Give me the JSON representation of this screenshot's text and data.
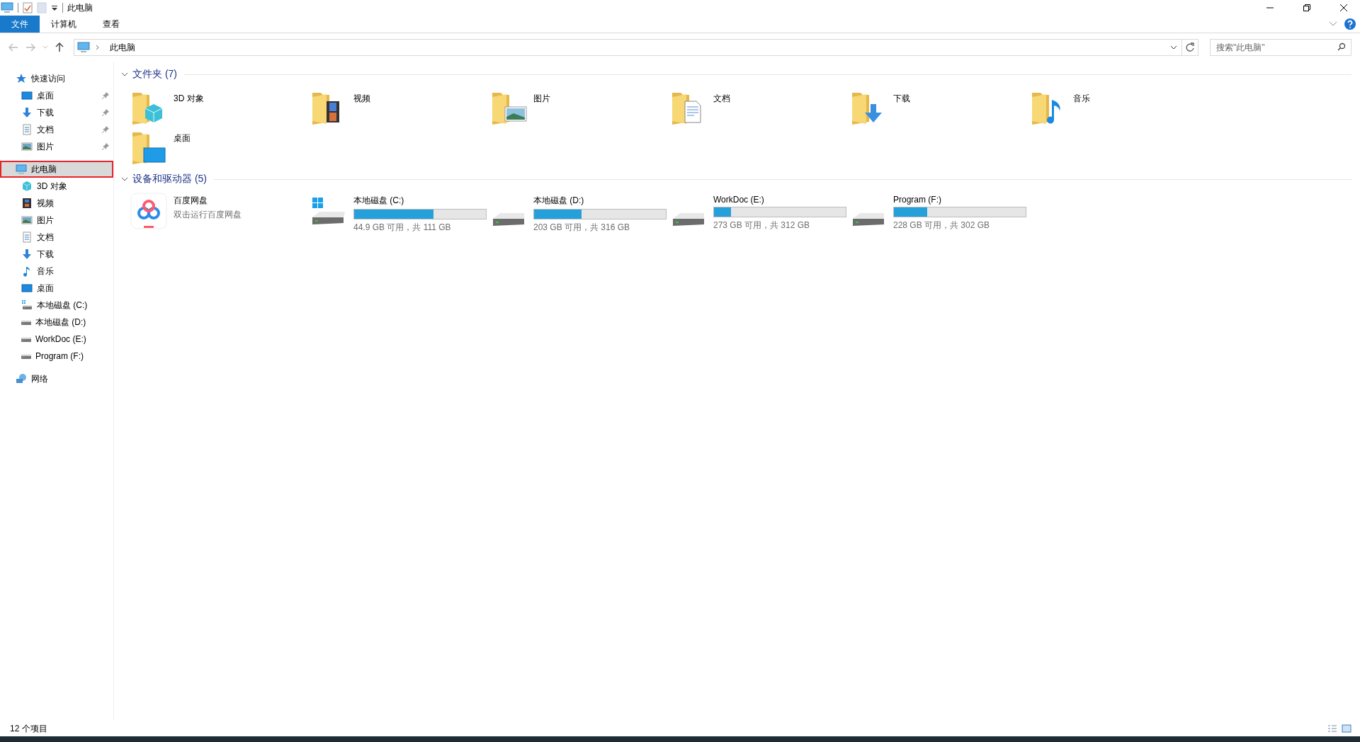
{
  "window": {
    "title": "此电脑"
  },
  "ribbon": {
    "tabs": [
      {
        "label": "文件",
        "kind": "file"
      },
      {
        "label": "计算机",
        "kind": "tab"
      },
      {
        "label": "查看",
        "kind": "tab"
      }
    ]
  },
  "address_bar": {
    "path": "此电脑",
    "search": {
      "placeholder": "搜索\"此电脑\""
    }
  },
  "sidebar": {
    "items": [
      {
        "label": "快速访问",
        "kind": "star",
        "selected": false,
        "highlighted": false,
        "children": [
          {
            "label": "桌面",
            "kind": "desktop",
            "pinned": true,
            "selected": false,
            "highlighted": false
          },
          {
            "label": "下载",
            "kind": "downloads",
            "pinned": true,
            "selected": false,
            "highlighted": false
          },
          {
            "label": "文档",
            "kind": "documents",
            "pinned": true,
            "selected": false,
            "highlighted": false
          },
          {
            "label": "图片",
            "kind": "pictures",
            "pinned": true,
            "selected": false,
            "highlighted": false
          }
        ]
      },
      {
        "label": "此电脑",
        "kind": "pc",
        "selected": true,
        "highlighted": true,
        "children": [
          {
            "label": "3D 对象",
            "kind": "objects",
            "selected": false,
            "highlighted": false
          },
          {
            "label": "视频",
            "kind": "video",
            "selected": false,
            "highlighted": false
          },
          {
            "label": "图片",
            "kind": "pictures",
            "selected": false,
            "highlighted": false
          },
          {
            "label": "文档",
            "kind": "documents",
            "selected": false,
            "highlighted": false
          },
          {
            "label": "下载",
            "kind": "downloads",
            "selected": false,
            "highlighted": false
          },
          {
            "label": "音乐",
            "kind": "music",
            "selected": false,
            "highlighted": false
          },
          {
            "label": "桌面",
            "kind": "desktop",
            "selected": false,
            "highlighted": false
          },
          {
            "label": "本地磁盘 (C:)",
            "kind": "windrive",
            "selected": false,
            "highlighted": false
          },
          {
            "label": "本地磁盘 (D:)",
            "kind": "drive",
            "selected": false,
            "highlighted": false
          },
          {
            "label": "WorkDoc (E:)",
            "kind": "drive",
            "selected": false,
            "highlighted": false
          },
          {
            "label": "Program (F:)",
            "kind": "drive",
            "selected": false,
            "highlighted": false
          }
        ]
      },
      {
        "label": "网络",
        "kind": "network",
        "selected": false,
        "highlighted": false
      }
    ]
  },
  "folders": {
    "title": "文件夹 (7)",
    "items": [
      {
        "name": "3D 对象",
        "kind": "objects"
      },
      {
        "name": "视频",
        "kind": "video"
      },
      {
        "name": "图片",
        "kind": "pictures"
      },
      {
        "name": "文档",
        "kind": "documents"
      },
      {
        "name": "下载",
        "kind": "downloads"
      },
      {
        "name": "音乐",
        "kind": "music"
      },
      {
        "name": "桌面",
        "kind": "desktop"
      }
    ]
  },
  "devices": {
    "title": "设备和驱动器 (5)",
    "items": [
      {
        "kind": "app",
        "name": "百度网盘",
        "subtitle": "双击运行百度网盘"
      },
      {
        "kind": "windrive",
        "name": "本地磁盘 (C:)",
        "level": 0.6,
        "reading": "44.9 GB 可用，共 111 GB"
      },
      {
        "kind": "drive",
        "name": "本地磁盘 (D:)",
        "level": 0.36,
        "reading": "203 GB 可用，共 316 GB"
      },
      {
        "kind": "drive",
        "name": "WorkDoc (E:)",
        "level": 0.13,
        "reading": "273 GB 可用，共 312 GB"
      },
      {
        "kind": "drive",
        "name": "Program (F:)",
        "level": 0.25,
        "reading": "228 GB 可用，共 302 GB"
      }
    ]
  },
  "status_bar": {
    "count": "12 个项目"
  }
}
